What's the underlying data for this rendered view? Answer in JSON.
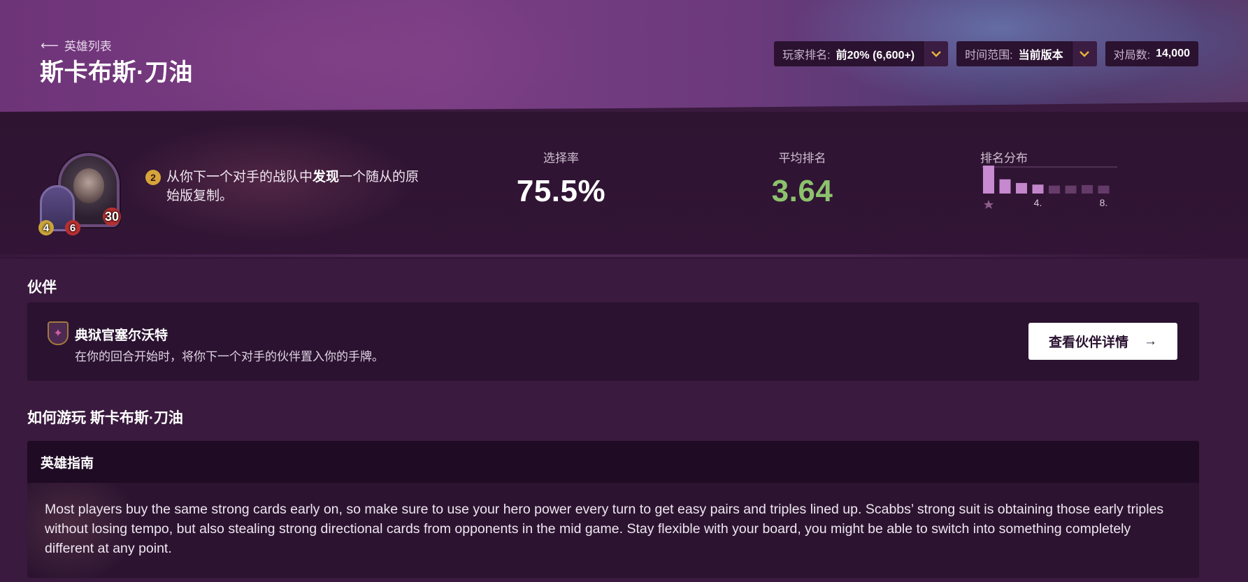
{
  "header": {
    "back_label": "英雄列表",
    "title": "斯卡布斯·刀油",
    "filters": [
      {
        "label": "玩家排名:",
        "value": "前20% (6,600+)",
        "has_dropdown": true
      },
      {
        "label": "时间范围:",
        "value": "当前版本",
        "has_dropdown": true
      },
      {
        "label": "对局数:",
        "value": "14,000",
        "has_dropdown": false
      }
    ]
  },
  "hero": {
    "buddy_attack": "4",
    "buddy_health": "6",
    "armor": "30",
    "power_cost": "2",
    "power_text_before": "从你下一个对手的战队中",
    "power_text_bold": "发现",
    "power_text_after": "一个随从的原始版复制。"
  },
  "stats": {
    "pick_rate_label": "选择率",
    "pick_rate_value": "75.5%",
    "avg_place_label": "平均排名",
    "avg_place_value": "3.64",
    "distribution_label": "排名分布",
    "dist_tick_4": "4.",
    "dist_tick_8": "8."
  },
  "chart_data": {
    "type": "bar",
    "categories": [
      "1",
      "2",
      "3",
      "4",
      "5",
      "6",
      "7",
      "8"
    ],
    "values": [
      26.5,
      13.5,
      10.0,
      8.5,
      7.5,
      7.5,
      8.0,
      7.5
    ],
    "tick_labels": [
      "",
      "",
      "",
      "4.",
      "",
      "",
      "",
      "8."
    ],
    "colors": {
      "top": "#c88ad0",
      "bottom": "#6a3f6e"
    }
  },
  "partner": {
    "section_title": "伙伴",
    "name": "典狱官塞尔沃特",
    "description": "在你的回合开始时，将你下一个对手的伙伴置入你的手牌。",
    "button_label": "查看伙伴详情",
    "button_arrow": "→"
  },
  "guide": {
    "section_title": "如何游玩 斯卡布斯·刀油",
    "card_title": "英雄指南",
    "body": "Most players buy the same strong cards early on, so make sure to use your hero power every turn to get easy pairs and triples lined up. Scabbs’ strong suit is obtaining those early triples without losing tempo, but also stealing strong directional cards from opponents in the mid game. Stay flexible with your board, you might be able to switch into something completely different at any point."
  },
  "colors": {
    "accent_gold": "#e8b23a",
    "avg_green": "#8cc26c",
    "background": "#3a1a3e",
    "panel": "#2a1230"
  },
  "icons": {
    "back": "arrow-left-icon",
    "dropdown": "chevron-down-icon",
    "button_arrow": "arrow-right-icon"
  }
}
